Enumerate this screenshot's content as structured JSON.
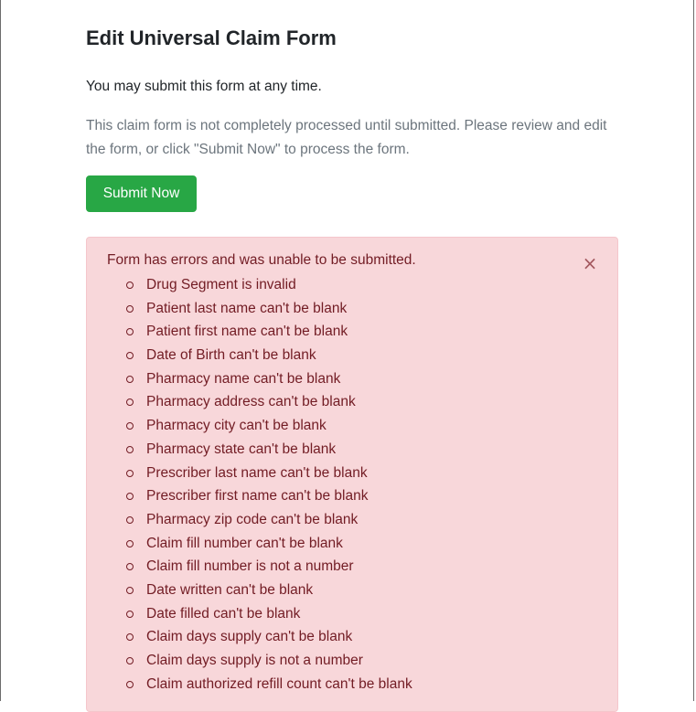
{
  "page": {
    "title": "Edit Universal Claim Form",
    "lead": "You may submit this form at any time.",
    "note": "This claim form is not completely processed until submitted. Please review and edit the form, or click \"Submit Now\" to process the form.",
    "submit_label": "Submit Now"
  },
  "alert": {
    "heading": "Form has errors and was unable to be submitted.",
    "close_label": "×",
    "errors": [
      "Drug Segment is invalid",
      "Patient last name can't be blank",
      "Patient first name can't be blank",
      "Date of Birth can't be blank",
      "Pharmacy name can't be blank",
      "Pharmacy address can't be blank",
      "Pharmacy city can't be blank",
      "Pharmacy state can't be blank",
      "Prescriber last name can't be blank",
      "Prescriber first name can't be blank",
      "Pharmacy zip code can't be blank",
      "Claim fill number can't be blank",
      "Claim fill number is not a number",
      "Date written can't be blank",
      "Date filled can't be blank",
      "Claim days supply can't be blank",
      "Claim days supply is not a number",
      "Claim authorized refill count can't be blank"
    ]
  },
  "colors": {
    "submit_button": "#28a745",
    "alert_background": "#f8d7da",
    "alert_text": "#721c24",
    "muted_text": "#6c757d"
  },
  "icons": {
    "close": "close-icon",
    "bullet": "circle-bullet-icon"
  }
}
